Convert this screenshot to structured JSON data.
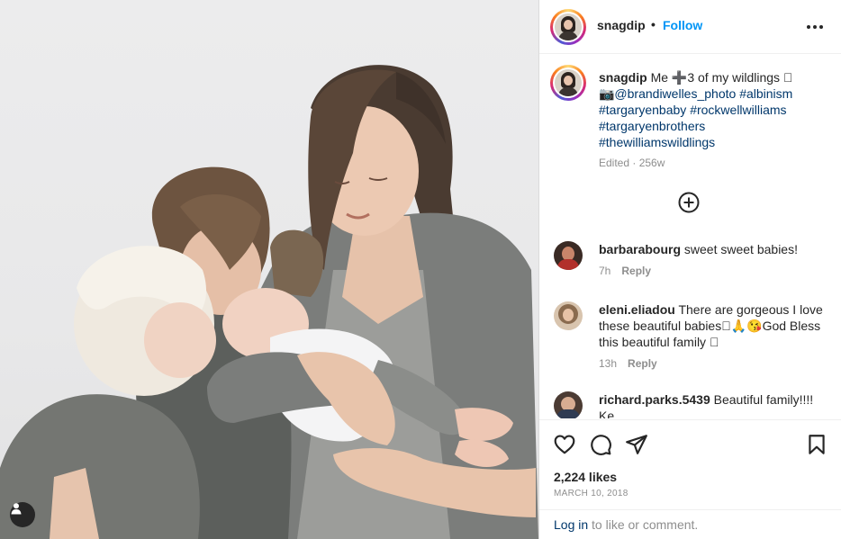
{
  "post": {
    "username": "snagdip",
    "follow_label": "Follow",
    "caption": {
      "username": "snagdip",
      "text_parts": [
        "Me ➕3 of my wildlings 🏽",
        "📷@brandiwelles_photo",
        "#albinism",
        "#targaryenbaby",
        "#rockwellwilliams",
        "#targaryenbrothers",
        "#thewilliamswildlings"
      ],
      "meta": "Edited · 256w"
    },
    "comments": [
      {
        "username": "barbarabourg",
        "text": "sweet sweet babies!",
        "age": "7h",
        "reply": "Reply"
      },
      {
        "username": "eleni.eliadou",
        "text": "There are gorgeous I love these beautiful babies🏽🙏😘God Bless this beautiful family 🏽",
        "age": "13h",
        "reply": "Reply"
      },
      {
        "username": "richard.parks.5439",
        "text": "Beautiful family!!!! Ke",
        "age": "",
        "reply": ""
      }
    ],
    "likes": "2,224 likes",
    "date": "MARCH 10, 2018",
    "login_link": "Log in",
    "login_rest": " to like or comment."
  },
  "icons": [
    "tag-user-icon",
    "more-options-icon",
    "load-more-comments-icon",
    "heart-icon",
    "comment-icon",
    "share-icon",
    "save-icon"
  ]
}
